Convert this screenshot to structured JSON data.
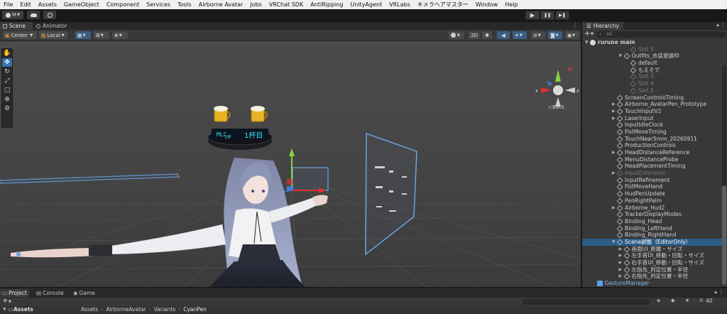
{
  "menu": [
    "File",
    "Edit",
    "Assets",
    "GameObject",
    "Component",
    "Services",
    "Tools",
    "Airborne Avatar",
    "Jobs",
    "VRChat SDK",
    "AntiRipping",
    "UnityAgent",
    "VRLabs",
    "キメラヘアマスター",
    "Window",
    "Help"
  ],
  "toolbar": {
    "account_label": "M",
    "play_icon": "▶",
    "pause_icon": "❚❚",
    "step_icon": "▶❚"
  },
  "scene": {
    "tabs": [
      "Scene",
      "Animator"
    ],
    "pivot": "Center",
    "space": "Local",
    "mode_2d": "2D",
    "gizmo_back": "Back",
    "gizmo_x": "x",
    "gizmo_z": "z",
    "hud": {
      "top_left": "MLC",
      "top_sub": "1杯",
      "top_right": "1杯目"
    }
  },
  "tools": [
    "hand-icon",
    "move-icon",
    "rotate-icon",
    "scale-icon",
    "rect-icon",
    "transform-icon"
  ],
  "hierarchy": {
    "title": "Hierarchy",
    "add": "+",
    "search_placeholder": "All",
    "rows": [
      {
        "label": "rurune main",
        "level": 0,
        "arrow": "▼",
        "type": "scene",
        "style": "bold"
      },
      {
        "label": "Slot 5",
        "level": 6,
        "arrow": "",
        "type": "cube",
        "style": "disabled"
      },
      {
        "label": "Outfits_衣装登録枠",
        "level": 5,
        "arrow": "▼",
        "type": "cube",
        "style": "normal"
      },
      {
        "label": "default",
        "level": 6,
        "arrow": "",
        "type": "cube",
        "style": "normal"
      },
      {
        "label": "もえそで",
        "level": 6,
        "arrow": "",
        "type": "cube",
        "style": "normal"
      },
      {
        "label": "Slot 3",
        "level": 6,
        "arrow": "",
        "type": "cube",
        "style": "disabled"
      },
      {
        "label": "Slot 4",
        "level": 6,
        "arrow": "",
        "type": "cube",
        "style": "disabled"
      },
      {
        "label": "Slot 5",
        "level": 6,
        "arrow": "",
        "type": "cube",
        "style": "disabled"
      },
      {
        "label": "ScreenControlsTiming",
        "level": 4,
        "arrow": "",
        "type": "cube",
        "style": "normal"
      },
      {
        "label": "Airborne_AvatarPen_Prototype",
        "level": 4,
        "arrow": "▶",
        "type": "cube",
        "style": "normal"
      },
      {
        "label": "TouchInputV2",
        "level": 4,
        "arrow": "▶",
        "type": "cube",
        "style": "normal"
      },
      {
        "label": "LaserInput",
        "level": 4,
        "arrow": "▶",
        "type": "cube",
        "style": "normal"
      },
      {
        "label": "InputIdleClock",
        "level": 4,
        "arrow": "",
        "type": "cube",
        "style": "normal"
      },
      {
        "label": "FistMoveTiming",
        "level": 4,
        "arrow": "",
        "type": "cube",
        "style": "normal"
      },
      {
        "label": "TouchNear5mm_20260911",
        "level": 4,
        "arrow": "",
        "type": "cube",
        "style": "normal"
      },
      {
        "label": "ProductionControls",
        "level": 4,
        "arrow": "",
        "type": "cube",
        "style": "normal"
      },
      {
        "label": "HeadDistanceReference",
        "level": 4,
        "arrow": "▶",
        "type": "cube",
        "style": "normal"
      },
      {
        "label": "MenuDistanceProbe",
        "level": 4,
        "arrow": "",
        "type": "cube",
        "style": "normal"
      },
      {
        "label": "HeadPlacementTiming",
        "level": 4,
        "arrow": "",
        "type": "cube",
        "style": "normal"
      },
      {
        "label": "InputExtension",
        "level": 4,
        "arrow": "▶",
        "type": "cube",
        "style": "disabled"
      },
      {
        "label": "InputRefinement",
        "level": 4,
        "arrow": "",
        "type": "cube",
        "style": "normal"
      },
      {
        "label": "FistMoveHand",
        "level": 4,
        "arrow": "",
        "type": "cube",
        "style": "normal"
      },
      {
        "label": "HudPenUpdate",
        "level": 4,
        "arrow": "",
        "type": "cube",
        "style": "normal"
      },
      {
        "label": "PenRightPalm",
        "level": 4,
        "arrow": "",
        "type": "cube",
        "style": "normal"
      },
      {
        "label": "Airborne_Hud2",
        "level": 4,
        "arrow": "▶",
        "type": "cube",
        "style": "normal"
      },
      {
        "label": "TrackerDisplayModes",
        "level": 4,
        "arrow": "",
        "type": "cube",
        "style": "normal"
      },
      {
        "label": "Binding_Head",
        "level": 4,
        "arrow": "",
        "type": "cube",
        "style": "normal"
      },
      {
        "label": "Binding_LeftHand",
        "level": 4,
        "arrow": "",
        "type": "cube",
        "style": "normal"
      },
      {
        "label": "Binding_RightHand",
        "level": 4,
        "arrow": "",
        "type": "cube",
        "style": "normal"
      },
      {
        "label": "Scene調整（EditorOnly）",
        "level": 4,
        "arrow": "▼",
        "type": "cube",
        "style": "selected"
      },
      {
        "label": "画面UI_距離・サイズ",
        "level": 5,
        "arrow": "▶",
        "type": "cube",
        "style": "normal"
      },
      {
        "label": "左手首UI_移動・回転・サイズ",
        "level": 5,
        "arrow": "▶",
        "type": "cube",
        "style": "normal"
      },
      {
        "label": "右手首UI_移動・回転・サイズ",
        "level": 5,
        "arrow": "▶",
        "type": "cube",
        "style": "normal"
      },
      {
        "label": "左指先_判定位置・半径",
        "level": 5,
        "arrow": "▶",
        "type": "cube",
        "style": "normal"
      },
      {
        "label": "右指先_判定位置・半径",
        "level": 5,
        "arrow": "▶",
        "type": "cube",
        "style": "normal"
      },
      {
        "label": "GestureManager",
        "level": 1,
        "arrow": "",
        "type": "blue",
        "style": "blue"
      }
    ]
  },
  "project": {
    "tabs": [
      "Project",
      "Console",
      "Game"
    ],
    "add": "+",
    "breadcrumb": [
      "Assets",
      "AirborneAvatar",
      "Variants",
      "CyanPen"
    ],
    "tree_root": "Assets",
    "count": "40"
  },
  "colors": {
    "accent": "#2c5d87",
    "menubar": "#f0f0f0",
    "scene_bg": "#474747"
  }
}
